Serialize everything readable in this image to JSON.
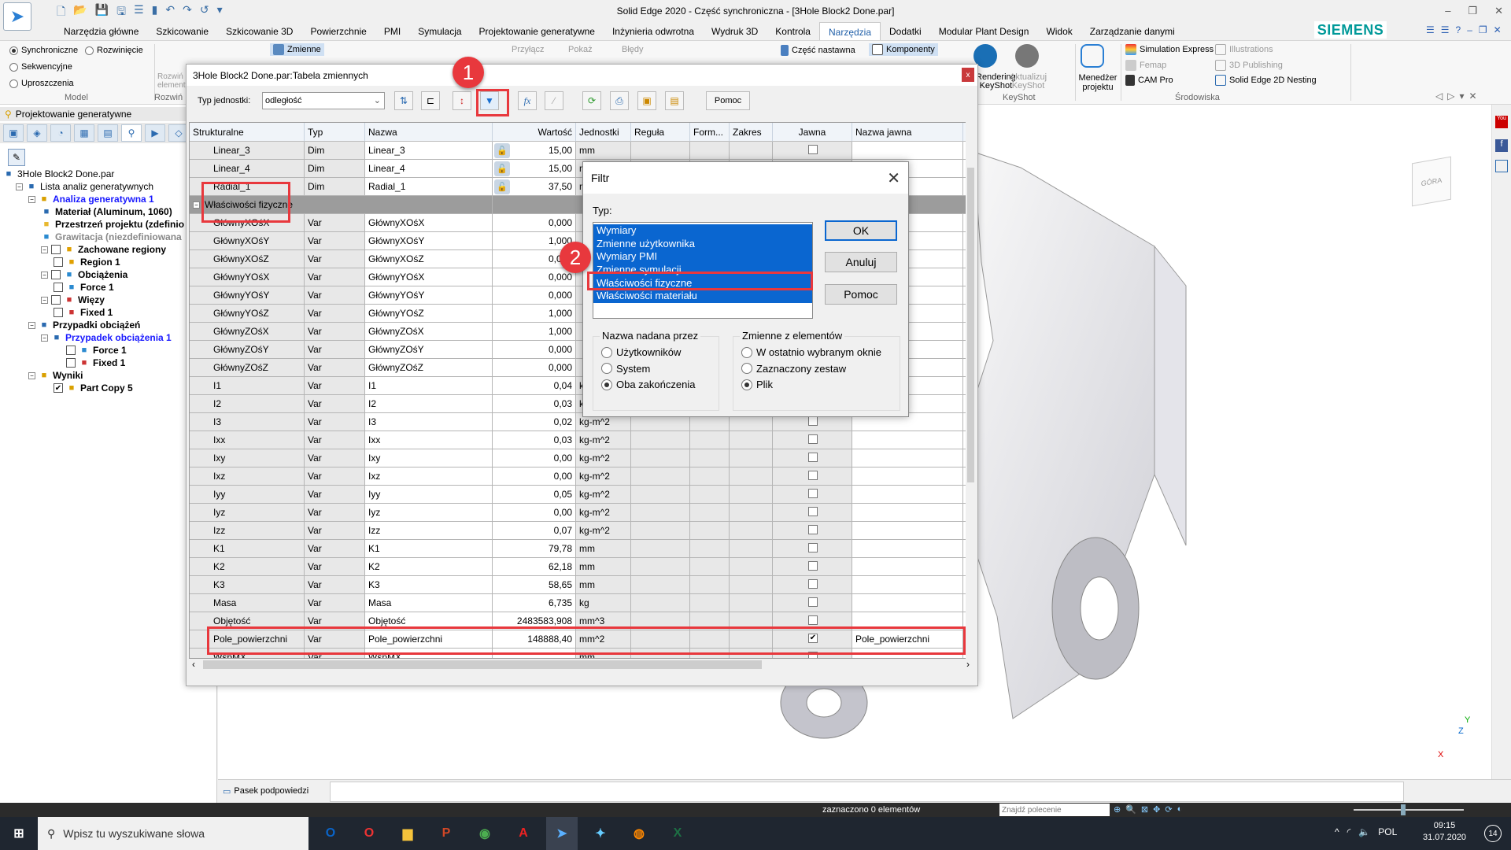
{
  "window": {
    "title": "Solid Edge 2020 - Część synchroniczna - [3Hole Block2 Done.par]"
  },
  "ribbon_tabs": [
    "Narzędzia główne",
    "Szkicowanie",
    "Szkicowanie 3D",
    "Powierzchnie",
    "PMI",
    "Symulacja",
    "Projektowanie generatywne",
    "Inżynieria odwrotna",
    "Wydruk 3D",
    "Kontrola",
    "Narzędzia",
    "Dodatki",
    "Modular Plant Design",
    "Widok",
    "Zarządzanie danymi"
  ],
  "active_tab": "Narzędzia",
  "brand": "SIEMENS",
  "ribbon": {
    "model": {
      "synchroniczne": "Synchroniczne",
      "rozwiniecie": "Rozwinięcie",
      "sekwencyjne": "Sekwencyjne",
      "uproszczenia": "Uproszczenia",
      "label": "Model"
    },
    "rozwin": {
      "button": "Rozwiń elementy",
      "label": "Rozwiń"
    },
    "zmienne": "Zmienne",
    "przylacz": "Przyłącz",
    "pokaz": "Pokaż",
    "bledy": "Błędy",
    "czesc_nastawna": "Część nastawna",
    "komponenty": "Komponenty",
    "rendering": "Rendering KeyShot",
    "aktualizuj": "Aktualizuj KeyShot",
    "keyshot_label": "KeyShot",
    "menedzer": "Menedżer projektu",
    "simulation_express": "Simulation Express",
    "femap": "Femap",
    "cam_pro": "CAM Pro",
    "illustrations": "Illustrations",
    "publishing": "3D Publishing",
    "nesting": "Solid Edge 2D Nesting",
    "srodowiska_label": "Środowiska"
  },
  "left_panel": {
    "title": "Projektowanie generatywne",
    "tree": [
      {
        "label": "3Hole Block2 Done.par",
        "level": 0,
        "icon": "part-icon"
      },
      {
        "label": "Lista analiz generatywnych",
        "level": 1,
        "expander": true,
        "icon": "list-icon"
      },
      {
        "label": "Analiza generatywna 1",
        "level": 2,
        "expander": true,
        "icon": "study-icon",
        "style": "blue"
      },
      {
        "label": "Materiał (Aluminum, 1060)",
        "level": 3,
        "icon": "material-icon",
        "style": "bold"
      },
      {
        "label": "Przestrzeń projektu (zdefinio",
        "level": 3,
        "icon": "design-space-icon",
        "style": "bold"
      },
      {
        "label": "Grawitacja (niezdefiniowana",
        "level": 3,
        "icon": "gravity-icon",
        "style": "gray"
      },
      {
        "label": "Zachowane regiony",
        "level": 3,
        "expander": true,
        "checkbox": false,
        "icon": "region-icon",
        "style": "bold"
      },
      {
        "label": "Region 1",
        "level": 4,
        "checkbox": false,
        "icon": "region-icon",
        "style": "bold"
      },
      {
        "label": "Obciążenia",
        "level": 3,
        "expander": true,
        "checkbox": false,
        "icon": "load-icon",
        "style": "bold"
      },
      {
        "label": "Force 1",
        "level": 4,
        "checkbox": false,
        "icon": "force-icon",
        "style": "bold"
      },
      {
        "label": "Więzy",
        "level": 3,
        "expander": true,
        "checkbox": false,
        "icon": "constraint-icon",
        "style": "bold"
      },
      {
        "label": "Fixed 1",
        "level": 4,
        "checkbox": false,
        "icon": "fixed-icon",
        "style": "bold"
      },
      {
        "label": "Przypadki obciążeń",
        "level": 2,
        "expander": true,
        "icon": "load-case-icon",
        "style": "bold"
      },
      {
        "label": "Przypadek obciążenia 1",
        "level": 3,
        "expander": true,
        "icon": "load-case-icon",
        "style": "blue"
      },
      {
        "label": "Force 1",
        "level": 5,
        "checkbox": false,
        "icon": "force-icon",
        "style": "bold"
      },
      {
        "label": "Fixed 1",
        "level": 5,
        "checkbox": false,
        "icon": "fixed-icon",
        "style": "bold"
      },
      {
        "label": "Wyniki",
        "level": 2,
        "expander": true,
        "icon": "results-icon",
        "style": "bold"
      },
      {
        "label": "Part Copy 5",
        "level": 4,
        "checkbox": true,
        "icon": "results-icon",
        "style": "bold"
      }
    ]
  },
  "variable_table": {
    "title": "3Hole Block2 Done.par:Tabela zmiennych",
    "unit_type_label": "Typ jednostki:",
    "unit_type_value": "odległość",
    "help_button": "Pomoc",
    "close": "x",
    "columns": [
      "Strukturalne",
      "Typ",
      "Nazwa",
      "Wartość",
      "Jednostki",
      "Reguła",
      "Form...",
      "Zakres",
      "Jawna",
      "Nazwa jawna"
    ],
    "rows": [
      {
        "s": "Linear_3",
        "t": "Dim",
        "n": "Linear_3",
        "v": "15,00",
        "u": "mm",
        "lock": true,
        "j": false,
        "nj": ""
      },
      {
        "s": "Linear_4",
        "t": "Dim",
        "n": "Linear_4",
        "v": "15,00",
        "u": "mm",
        "lock": true,
        "j": false,
        "nj": ""
      },
      {
        "s": "Radial_1",
        "t": "Dim",
        "n": "Radial_1",
        "v": "37,50",
        "u": "mm",
        "lock": true,
        "j": false,
        "nj": ""
      },
      {
        "group": "Właściwości fizyczne"
      },
      {
        "s": "GłównyXOśX",
        "t": "Var",
        "n": "GłównyXOśX",
        "v": "0,000",
        "u": "",
        "j": false,
        "nj": ""
      },
      {
        "s": "GłównyXOśY",
        "t": "Var",
        "n": "GłównyXOśY",
        "v": "1,000",
        "u": "",
        "j": false,
        "nj": ""
      },
      {
        "s": "GłównyXOśZ",
        "t": "Var",
        "n": "GłównyXOśZ",
        "v": "0,000",
        "u": "",
        "j": false,
        "nj": ""
      },
      {
        "s": "GłównyYOśX",
        "t": "Var",
        "n": "GłównyYOśX",
        "v": "0,000",
        "u": "",
        "j": false,
        "nj": ""
      },
      {
        "s": "GłównyYOśY",
        "t": "Var",
        "n": "GłównyYOśY",
        "v": "0,000",
        "u": "",
        "j": false,
        "nj": ""
      },
      {
        "s": "GłównyYOśZ",
        "t": "Var",
        "n": "GłównyYOśZ",
        "v": "1,000",
        "u": "",
        "j": false,
        "nj": ""
      },
      {
        "s": "GłównyZOśX",
        "t": "Var",
        "n": "GłównyZOśX",
        "v": "1,000",
        "u": "",
        "j": false,
        "nj": ""
      },
      {
        "s": "GłównyZOśY",
        "t": "Var",
        "n": "GłównyZOśY",
        "v": "0,000",
        "u": "",
        "j": false,
        "nj": ""
      },
      {
        "s": "GłównyZOśZ",
        "t": "Var",
        "n": "GłównyZOśZ",
        "v": "0,000",
        "u": "",
        "j": false,
        "nj": ""
      },
      {
        "s": "I1",
        "t": "Var",
        "n": "I1",
        "v": "0,04",
        "u": "kg-m^2",
        "j": false,
        "nj": ""
      },
      {
        "s": "I2",
        "t": "Var",
        "n": "I2",
        "v": "0,03",
        "u": "kg-m^2",
        "j": false,
        "nj": ""
      },
      {
        "s": "I3",
        "t": "Var",
        "n": "I3",
        "v": "0,02",
        "u": "kg-m^2",
        "j": false,
        "nj": ""
      },
      {
        "s": "Ixx",
        "t": "Var",
        "n": "Ixx",
        "v": "0,03",
        "u": "kg-m^2",
        "j": false,
        "nj": ""
      },
      {
        "s": "Ixy",
        "t": "Var",
        "n": "Ixy",
        "v": "0,00",
        "u": "kg-m^2",
        "j": false,
        "nj": ""
      },
      {
        "s": "Ixz",
        "t": "Var",
        "n": "Ixz",
        "v": "0,00",
        "u": "kg-m^2",
        "j": false,
        "nj": ""
      },
      {
        "s": "Iyy",
        "t": "Var",
        "n": "Iyy",
        "v": "0,05",
        "u": "kg-m^2",
        "j": false,
        "nj": ""
      },
      {
        "s": "Iyz",
        "t": "Var",
        "n": "Iyz",
        "v": "0,00",
        "u": "kg-m^2",
        "j": false,
        "nj": ""
      },
      {
        "s": "Izz",
        "t": "Var",
        "n": "Izz",
        "v": "0,07",
        "u": "kg-m^2",
        "j": false,
        "nj": ""
      },
      {
        "s": "K1",
        "t": "Var",
        "n": "K1",
        "v": "79,78",
        "u": "mm",
        "j": false,
        "nj": ""
      },
      {
        "s": "K2",
        "t": "Var",
        "n": "K2",
        "v": "62,18",
        "u": "mm",
        "j": false,
        "nj": ""
      },
      {
        "s": "K3",
        "t": "Var",
        "n": "K3",
        "v": "58,65",
        "u": "mm",
        "j": false,
        "nj": ""
      },
      {
        "s": "Masa",
        "t": "Var",
        "n": "Masa",
        "v": "6,735",
        "u": "kg",
        "j": false,
        "nj": ""
      },
      {
        "s": "Objętość",
        "t": "Var",
        "n": "Objętość",
        "v": "2483583,908",
        "u": "mm^3",
        "j": false,
        "nj": ""
      },
      {
        "s": "Pole_powierzchni",
        "t": "Var",
        "n": "Pole_powierzchni",
        "v": "148888,40",
        "u": "mm^2",
        "j": true,
        "nj": "Pole_powierzchni"
      },
      {
        "s": "WspMX",
        "t": "Var",
        "n": "WspMX",
        "v": "",
        "u": "mm",
        "j": false,
        "nj": ""
      }
    ]
  },
  "filter_dialog": {
    "title": "Filtr",
    "type_label": "Typ:",
    "types": [
      "Wymiary",
      "Zmienne użytkownika",
      "Wymiary PMI",
      "Zmienne symulacji",
      "Właściwości fizyczne",
      "Właściwości materiału"
    ],
    "ok": "OK",
    "cancel": "Anuluj",
    "help": "Pomoc",
    "named_by": {
      "legend": "Nazwa nadana przez",
      "options": [
        "Użytkowników",
        "System",
        "Oba zakończenia"
      ],
      "selected": "Oba zakończenia"
    },
    "from_elements": {
      "legend": "Zmienne z elementów",
      "options": [
        "W ostatnio wybranym oknie",
        "Zaznaczony zestaw",
        "Plik"
      ],
      "selected": "Plik"
    }
  },
  "annotations": {
    "step1": "1",
    "step2": "2",
    "color": "#e8383d"
  },
  "view": {
    "cube_label": "GÓRA",
    "axis_x": "X",
    "axis_y": "Y",
    "axis_z": "Z"
  },
  "hint_bar": {
    "label": "Pasek podpowiedzi"
  },
  "status": {
    "selection": "zaznaczono 0 elementów",
    "command_search_placeholder": "Znajdź polecenie"
  },
  "taskbar": {
    "search_placeholder": "Wpisz tu wyszukiwane słowa",
    "time": "09:15",
    "date": "31.07.2020",
    "lang": "POL",
    "notifications": "14"
  }
}
